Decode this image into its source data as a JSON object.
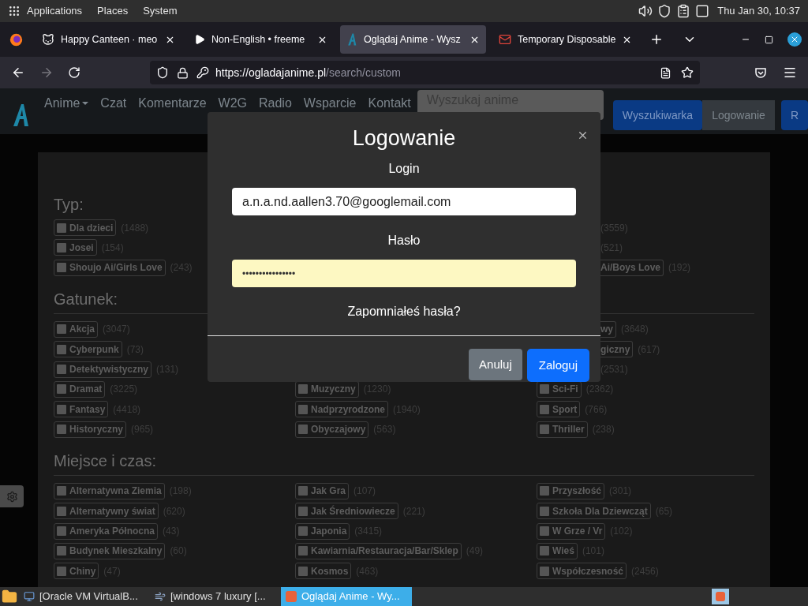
{
  "desktop_bar": {
    "menus": [
      "Applications",
      "Places",
      "System"
    ],
    "clock": "Thu Jan 30, 10:37"
  },
  "browser": {
    "tabs": [
      {
        "label": "Happy Canteen · meo",
        "selected": false
      },
      {
        "label": "Non-English • freeme",
        "selected": false
      },
      {
        "label": "Oglądaj Anime - Wysz",
        "selected": true
      },
      {
        "label": "Temporary Disposable",
        "selected": false
      }
    ],
    "url_host": "https://ogladajanime.pl",
    "url_path": "/search/custom"
  },
  "site_nav": {
    "items": [
      {
        "label": "Anime",
        "dropdown": true
      },
      {
        "label": "Czat",
        "dropdown": false
      },
      {
        "label": "Komentarze",
        "dropdown": false
      },
      {
        "label": "W2G",
        "dropdown": false
      },
      {
        "label": "Radio",
        "dropdown": false
      },
      {
        "label": "Wsparcie",
        "dropdown": false
      },
      {
        "label": "Kontakt",
        "dropdown": false
      }
    ],
    "search_placeholder": "Wyszukaj anime",
    "buttons": [
      {
        "label": "Wyszukiwarka",
        "kind": "primary"
      },
      {
        "label": "Logowanie",
        "kind": "secondary"
      },
      {
        "label": "R",
        "kind": "primary"
      }
    ]
  },
  "sections": [
    {
      "title": "Typ:",
      "divider": false,
      "columns": [
        [
          {
            "kind": "chip",
            "label": "Dla dzieci",
            "count": "(1488)",
            "checked": false
          },
          {
            "kind": "chip",
            "label": "Josei",
            "count": "(154)",
            "checked": false
          },
          {
            "kind": "chip",
            "label": "Shoujo Ai/Girls Love",
            "count": "(243)",
            "checked": false
          }
        ],
        [],
        [
          {
            "kind": "count",
            "count": "(3559)"
          },
          {
            "kind": "count",
            "count": "(521)"
          },
          {
            "kind": "fragment",
            "label": "Ai/Boys Love",
            "count": "(192)"
          }
        ]
      ]
    },
    {
      "title": "Gatunek:",
      "divider": true,
      "columns": [
        [
          {
            "kind": "chip",
            "label": "Akcja",
            "count": "(3047)",
            "checked": false
          },
          {
            "kind": "chip",
            "label": "Cyberpunk",
            "count": "(73)",
            "checked": false
          },
          {
            "kind": "chip",
            "label": "Detektywistyczny",
            "count": "(131)",
            "checked": false
          },
          {
            "kind": "chip",
            "label": "Dramat",
            "count": "(3225)",
            "checked": false
          },
          {
            "kind": "chip",
            "label": "Fantasy",
            "count": "(4418)",
            "checked": false
          },
          {
            "kind": "chip",
            "label": "Historyczny",
            "count": "(965)",
            "checked": false
          }
        ],
        [
          {
            "kind": "covered"
          },
          {
            "kind": "covered"
          },
          {
            "kind": "covered"
          },
          {
            "kind": "chip",
            "label": "Muzyczny",
            "count": "(1230)",
            "checked": false
          },
          {
            "kind": "chip",
            "label": "Nadprzyrodzone",
            "count": "(1940)",
            "checked": false
          },
          {
            "kind": "chip",
            "label": "Obyczajowy",
            "count": "(563)",
            "checked": false
          }
        ],
        [
          {
            "kind": "fragment",
            "label": "wy",
            "count": "(3648)"
          },
          {
            "kind": "fragment",
            "label": "giczny",
            "count": "(617)"
          },
          {
            "kind": "count",
            "count": "(2531)"
          },
          {
            "kind": "chip",
            "label": "Sci-Fi",
            "count": "(2362)",
            "checked": false
          },
          {
            "kind": "chip",
            "label": "Sport",
            "count": "(766)",
            "checked": false
          },
          {
            "kind": "chip",
            "label": "Thriller",
            "count": "(238)",
            "checked": false
          }
        ]
      ]
    },
    {
      "title": "Miejsce i czas:",
      "divider": true,
      "columns": [
        [
          {
            "kind": "chip",
            "label": "Alternatywna Ziemia",
            "count": "(198)",
            "checked": false
          },
          {
            "kind": "chip",
            "label": "Alternatywny świat",
            "count": "(620)",
            "checked": false
          },
          {
            "kind": "chip",
            "label": "Ameryka Północna",
            "count": "(43)",
            "checked": false
          },
          {
            "kind": "chip",
            "label": "Budynek Mieszkalny",
            "count": "(60)",
            "checked": false
          },
          {
            "kind": "chip",
            "label": "Chiny",
            "count": "(47)",
            "checked": false
          }
        ],
        [
          {
            "kind": "chip",
            "label": "Jak Gra",
            "count": "(107)",
            "checked": false
          },
          {
            "kind": "chip",
            "label": "Jak Średniowiecze",
            "count": "(221)",
            "checked": false
          },
          {
            "kind": "chip",
            "label": "Japonia",
            "count": "(3415)",
            "checked": false
          },
          {
            "kind": "chip",
            "label": "Kawiarnia/Restauracja/Bar/Sklep",
            "count": "(49)",
            "checked": false
          },
          {
            "kind": "chip",
            "label": "Kosmos",
            "count": "(463)",
            "checked": false
          }
        ],
        [
          {
            "kind": "chip",
            "label": "Przyszłość",
            "count": "(301)",
            "checked": false
          },
          {
            "kind": "chip",
            "label": "Szkoła Dla Dziewcząt",
            "count": "(65)",
            "checked": false
          },
          {
            "kind": "chip",
            "label": "W Grze / Vr",
            "count": "(102)",
            "checked": false
          },
          {
            "kind": "chip",
            "label": "Wieś",
            "count": "(101)",
            "checked": false
          },
          {
            "kind": "chip",
            "label": "Współczesność",
            "count": "(2456)",
            "checked": false
          }
        ]
      ]
    }
  ],
  "login_modal": {
    "title": "Logowanie",
    "login_label": "Login",
    "login_value": "a.n.a.nd.aallen3.70@googlemail.com",
    "password_label": "Hasło",
    "password_value": "••••••••••••••••",
    "forgot_link": "Zapomniałeś hasła?",
    "cancel": "Anuluj",
    "submit": "Zaloguj"
  },
  "taskbar": {
    "items": [
      {
        "label": "[Oracle VM VirtualB...",
        "selected": false
      },
      {
        "label": "[windows 7 luxury [...",
        "selected": false
      },
      {
        "label": "Oglądaj Anime - Wy...",
        "selected": true
      }
    ]
  }
}
